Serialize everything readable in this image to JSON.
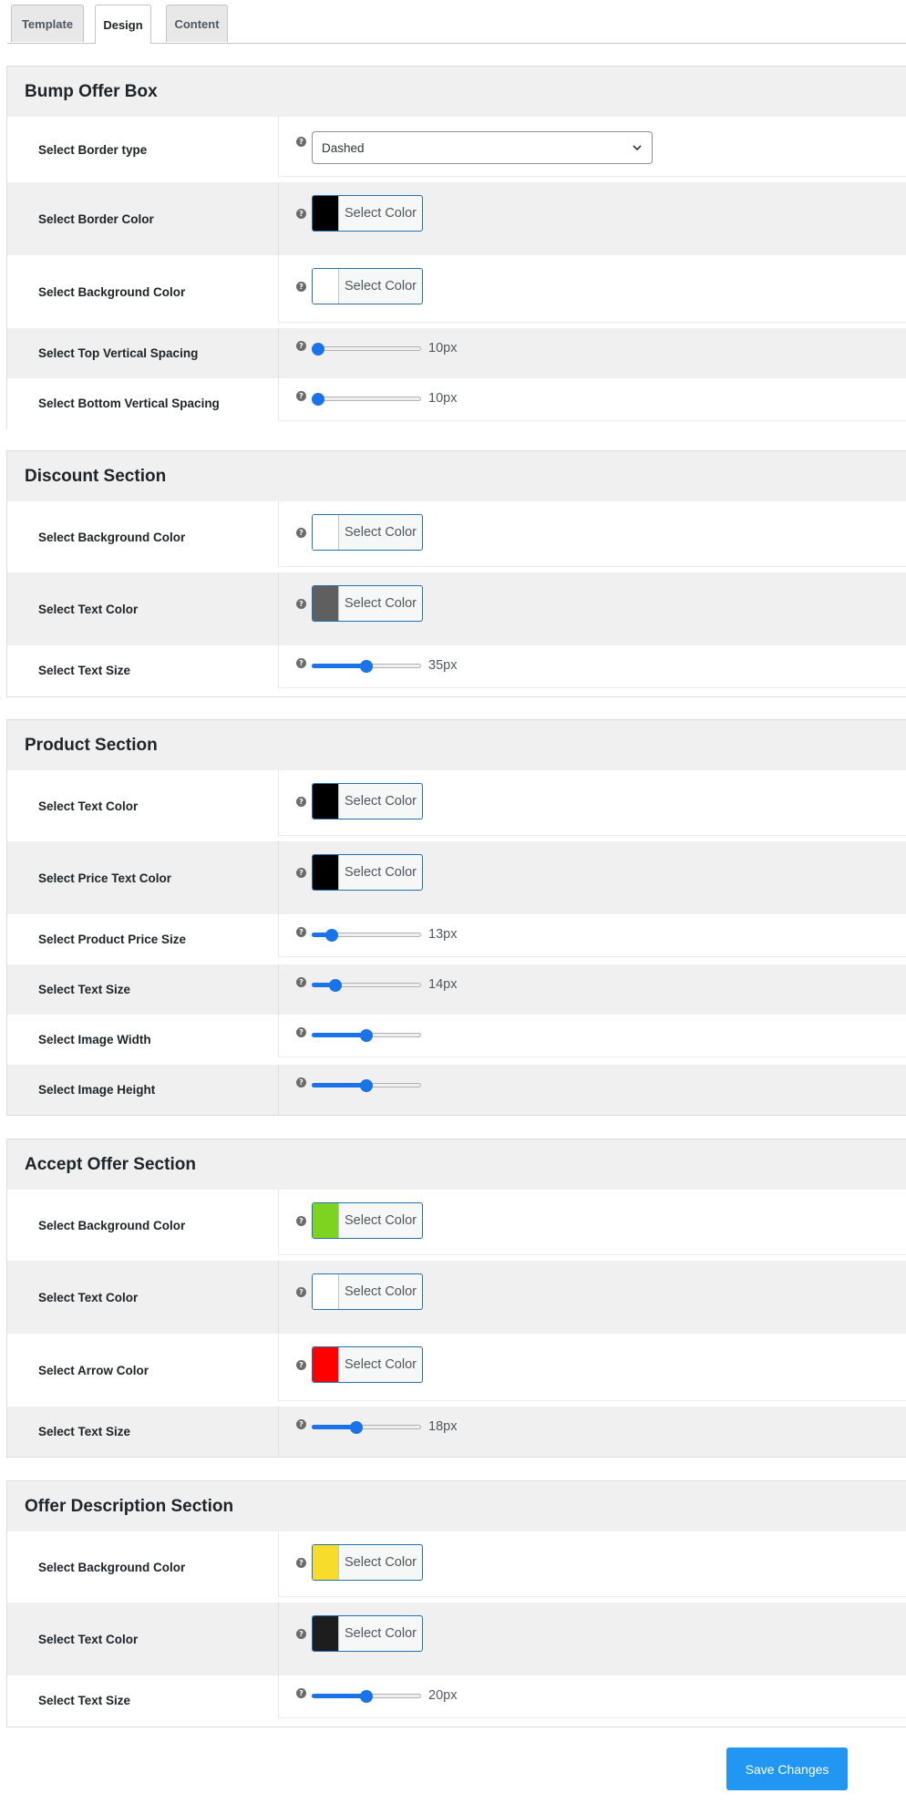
{
  "tabs": [
    {
      "label": "Template",
      "active": false
    },
    {
      "label": "Design",
      "active": true
    },
    {
      "label": "Content",
      "active": false
    }
  ],
  "sections": [
    {
      "title": "Bump Offer Box",
      "rows": [
        {
          "label": "Select Border type",
          "control": "select",
          "value": "Dashed"
        },
        {
          "label": "Select Border Color",
          "control": "color",
          "button_text": "Select Color",
          "swatch": "#000000"
        },
        {
          "label": "Select Background Color",
          "control": "color",
          "button_text": "Select Color",
          "swatch": "#ffffff"
        },
        {
          "label": "Select Top Vertical Spacing",
          "control": "slider",
          "fraction": 0.05,
          "value_text": "10px"
        },
        {
          "label": "Select Bottom Vertical Spacing",
          "control": "slider",
          "fraction": 0.05,
          "value_text": "10px"
        }
      ]
    },
    {
      "title": "Discount Section",
      "rows": [
        {
          "label": "Select Background Color",
          "control": "color",
          "button_text": "Select Color",
          "swatch": "#ffffff"
        },
        {
          "label": "Select Text Color",
          "control": "color",
          "button_text": "Select Color",
          "swatch": "#5f5f5f"
        },
        {
          "label": "Select Text Size",
          "control": "slider",
          "fraction": 0.5,
          "value_text": "35px"
        }
      ]
    },
    {
      "title": "Product Section",
      "rows": [
        {
          "label": "Select Text Color",
          "control": "color",
          "button_text": "Select Color",
          "swatch": "#000000"
        },
        {
          "label": "Select Price Text Color",
          "control": "color",
          "button_text": "Select Color",
          "swatch": "#000000"
        },
        {
          "label": "Select Product Price Size",
          "control": "slider",
          "fraction": 0.18,
          "value_text": "13px"
        },
        {
          "label": "Select Text Size",
          "control": "slider",
          "fraction": 0.22,
          "value_text": "14px"
        },
        {
          "label": "Select Image Width",
          "control": "slider",
          "fraction": 0.5,
          "value_text": ""
        },
        {
          "label": "Select Image Height",
          "control": "slider",
          "fraction": 0.5,
          "value_text": ""
        }
      ]
    },
    {
      "title": "Accept Offer Section",
      "rows": [
        {
          "label": "Select Background Color",
          "control": "color",
          "button_text": "Select Color",
          "swatch": "#7ed321"
        },
        {
          "label": "Select Text Color",
          "control": "color",
          "button_text": "Select Color",
          "swatch": "#ffffff"
        },
        {
          "label": "Select Arrow Color",
          "control": "color",
          "button_text": "Select Color",
          "swatch": "#ff0000"
        },
        {
          "label": "Select Text Size",
          "control": "slider",
          "fraction": 0.41,
          "value_text": "18px"
        }
      ]
    },
    {
      "title": "Offer Description Section",
      "rows": [
        {
          "label": "Select Background Color",
          "control": "color",
          "button_text": "Select Color",
          "swatch": "#f8dc2b"
        },
        {
          "label": "Select Text Color",
          "control": "color",
          "button_text": "Select Color",
          "swatch": "#1d1d1d"
        },
        {
          "label": "Select Text Size",
          "control": "slider",
          "fraction": 0.5,
          "value_text": "20px"
        }
      ]
    }
  ],
  "save_button": "Save Changes",
  "help_glyph": "?",
  "colors": {
    "accent": "#1a73e8",
    "save": "#2196f3",
    "header_bg": "#f0f0f1"
  }
}
